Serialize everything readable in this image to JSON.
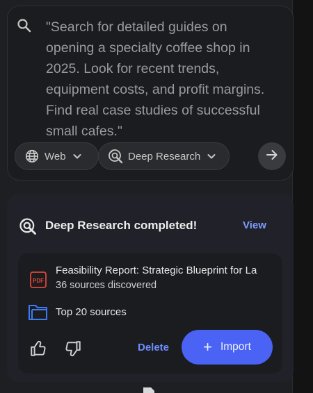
{
  "query": {
    "text": "\"Search for detailed guides on opening a specialty coffee shop in 2025. Look for recent trends, equipment costs, and profit margins. Find real case studies of successful small cafes.\"",
    "source_chip": {
      "label": "Web",
      "icon": "globe-icon"
    },
    "mode_chip": {
      "label": "Deep Research",
      "icon": "deep-research-icon"
    },
    "send_icon": "arrow-right-icon"
  },
  "result": {
    "status_title": "Deep Research completed!",
    "view_label": "View",
    "report": {
      "title": "Feasibility Report: Strategic Blueprint for La",
      "sources_discovered": "36 sources discovered",
      "top_sources_label": "Top 20 sources",
      "pdf_icon_text": "PDF"
    },
    "delete_label": "Delete",
    "import_label": "Import"
  },
  "colors": {
    "accent": "#4a63f5",
    "link": "#7c9cff",
    "pdf_red": "#e0453a",
    "folder_blue": "#3d7bf5"
  }
}
